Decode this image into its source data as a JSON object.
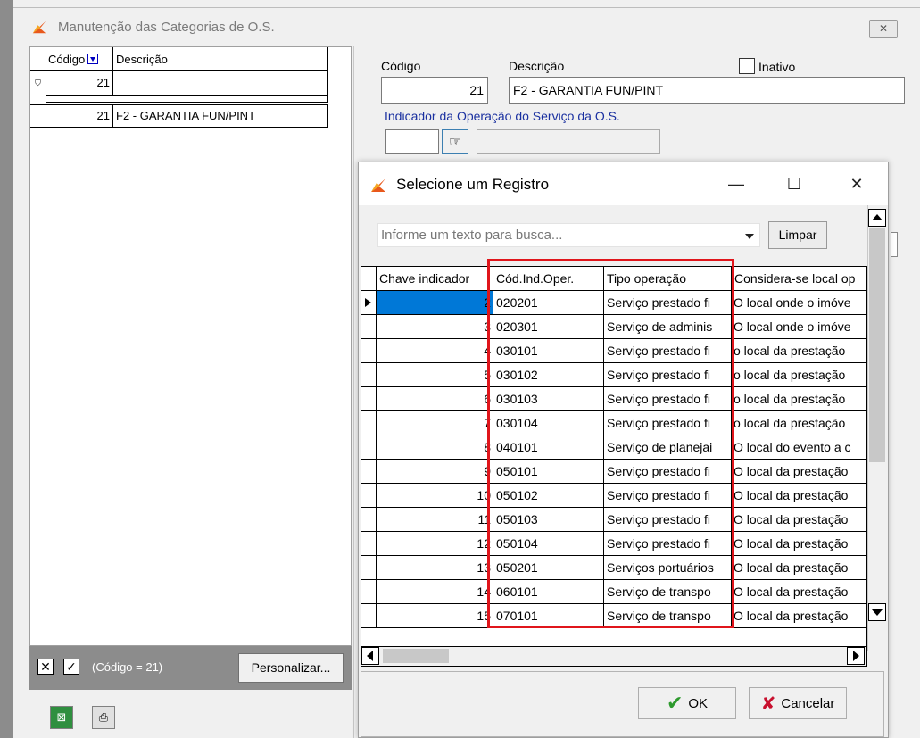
{
  "main": {
    "title": "Manutenção das Categorias de O.S.",
    "close_label": "✕",
    "left_grid": {
      "col_codigo": "Código",
      "col_descricao": "Descrição",
      "filter_codigo": "21",
      "row_codigo": "21",
      "row_descricao": "F2 - GARANTIA FUN/PINT"
    },
    "bottom": {
      "filter_text": "(Código = 21)",
      "personalizar": "Personalizar..."
    },
    "form": {
      "codigo_label": "Código",
      "codigo_value": "21",
      "descricao_label": "Descrição",
      "descricao_value": "F2 - GARANTIA FUN/PINT",
      "inativo_label": "Inativo",
      "indicador_label": "Indicador da Operação do Serviço  da O.S."
    }
  },
  "dialog": {
    "title": "Selecione um Registro",
    "search_placeholder": "Informe um texto para busca...",
    "limpar": "Limpar",
    "ok": "OK",
    "cancelar": "Cancelar",
    "columns": [
      "Chave indicador",
      "Cód.Ind.Oper.",
      "Tipo operação",
      "Considera-se local op"
    ],
    "rows": [
      {
        "chave": "2",
        "cod": "020201",
        "tipo": "Serviço prestado fi",
        "local": "O local onde o imóve"
      },
      {
        "chave": "3",
        "cod": "020301",
        "tipo": "Serviço de adminis",
        "local": "O local onde o imóve"
      },
      {
        "chave": "4",
        "cod": "030101",
        "tipo": "Serviço prestado fi",
        "local": "o local da prestação"
      },
      {
        "chave": "5",
        "cod": "030102",
        "tipo": "Serviço prestado fi",
        "local": "o local da prestação"
      },
      {
        "chave": "6",
        "cod": "030103",
        "tipo": "Serviço prestado fi",
        "local": "o local da prestação"
      },
      {
        "chave": "7",
        "cod": "030104",
        "tipo": "Serviço prestado fi",
        "local": "o local da prestação"
      },
      {
        "chave": "8",
        "cod": "040101",
        "tipo": "Serviço de planejai",
        "local": "O local do evento a c"
      },
      {
        "chave": "9",
        "cod": "050101",
        "tipo": "Serviço prestado fi",
        "local": "O local da prestação"
      },
      {
        "chave": "10",
        "cod": "050102",
        "tipo": "Serviço prestado fi",
        "local": "O local da prestação"
      },
      {
        "chave": "11",
        "cod": "050103",
        "tipo": "Serviço prestado fi",
        "local": "O local da prestação"
      },
      {
        "chave": "12",
        "cod": "050104",
        "tipo": "Serviço prestado fi",
        "local": "O local da prestação"
      },
      {
        "chave": "13",
        "cod": "050201",
        "tipo": "Serviços portuários",
        "local": "O local da prestação"
      },
      {
        "chave": "14",
        "cod": "060101",
        "tipo": "Serviço de transpo",
        "local": "O local da prestação"
      },
      {
        "chave": "15",
        "cod": "070101",
        "tipo": "Serviço de transpo",
        "local": "O local da prestação"
      }
    ]
  },
  "colors": {
    "highlight_border": "#e0151b",
    "selection": "#0078d7",
    "label_blue": "#1a30a0"
  }
}
